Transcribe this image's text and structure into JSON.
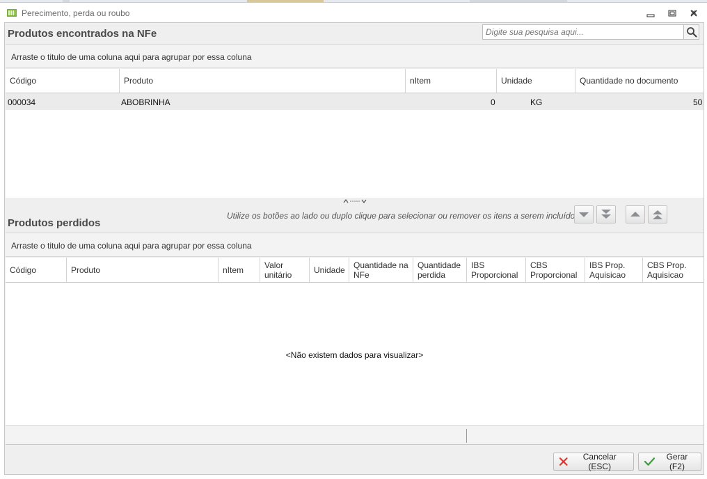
{
  "window": {
    "title": "Perecimento, perda ou roubo"
  },
  "top_panel": {
    "title": "Produtos encontrados na NFe",
    "search_placeholder": "Digite sua pesquisa aqui...",
    "group_hint": "Arraste o titulo de uma coluna aqui para agrupar por essa coluna",
    "columns": [
      "Código",
      "Produto",
      "nItem",
      "Unidade",
      "Quantidade no documento"
    ],
    "rows": [
      {
        "codigo": "000034",
        "produto": "ABOBRINHA",
        "nitem": "0",
        "unidade": "KG",
        "quantidade": "50"
      }
    ]
  },
  "bottom_panel": {
    "title": "Produtos perdidos",
    "hint": "Utilize os botões ao lado ou duplo clique para selecionar ou remover os itens a serem incluídos",
    "group_hint": "Arraste o titulo de uma coluna aqui para agrupar por essa coluna",
    "columns": [
      [
        "Código",
        ""
      ],
      [
        "Produto",
        ""
      ],
      [
        "nItem",
        ""
      ],
      [
        "Valor",
        "unitário"
      ],
      [
        "Unidade",
        ""
      ],
      [
        "Quantidade na",
        "NFe"
      ],
      [
        "Quantidade",
        "perdida"
      ],
      [
        "IBS",
        "Proporcional"
      ],
      [
        "CBS",
        "Proporcional"
      ],
      [
        "IBS Prop.",
        "Aquisicao"
      ],
      [
        "CBS Prop.",
        "Aquisicao"
      ]
    ],
    "empty_message": "<Não existem dados para visualizar>"
  },
  "buttons": {
    "cancel": "Cancelar (ESC)",
    "generate": "Gerar (F2)"
  },
  "icons": {
    "app": "app-icon",
    "search": "search-icon",
    "move_down": "chevron-down-icon",
    "move_all_down": "double-chevron-down-icon",
    "move_up": "chevron-up-icon",
    "move_all_up": "double-chevron-up-icon",
    "cancel": "x-icon",
    "generate": "check-icon"
  },
  "colors": {
    "cancel_x": "#d9362b",
    "check": "#3a9e3a",
    "app_icon": "#7bb33a"
  }
}
